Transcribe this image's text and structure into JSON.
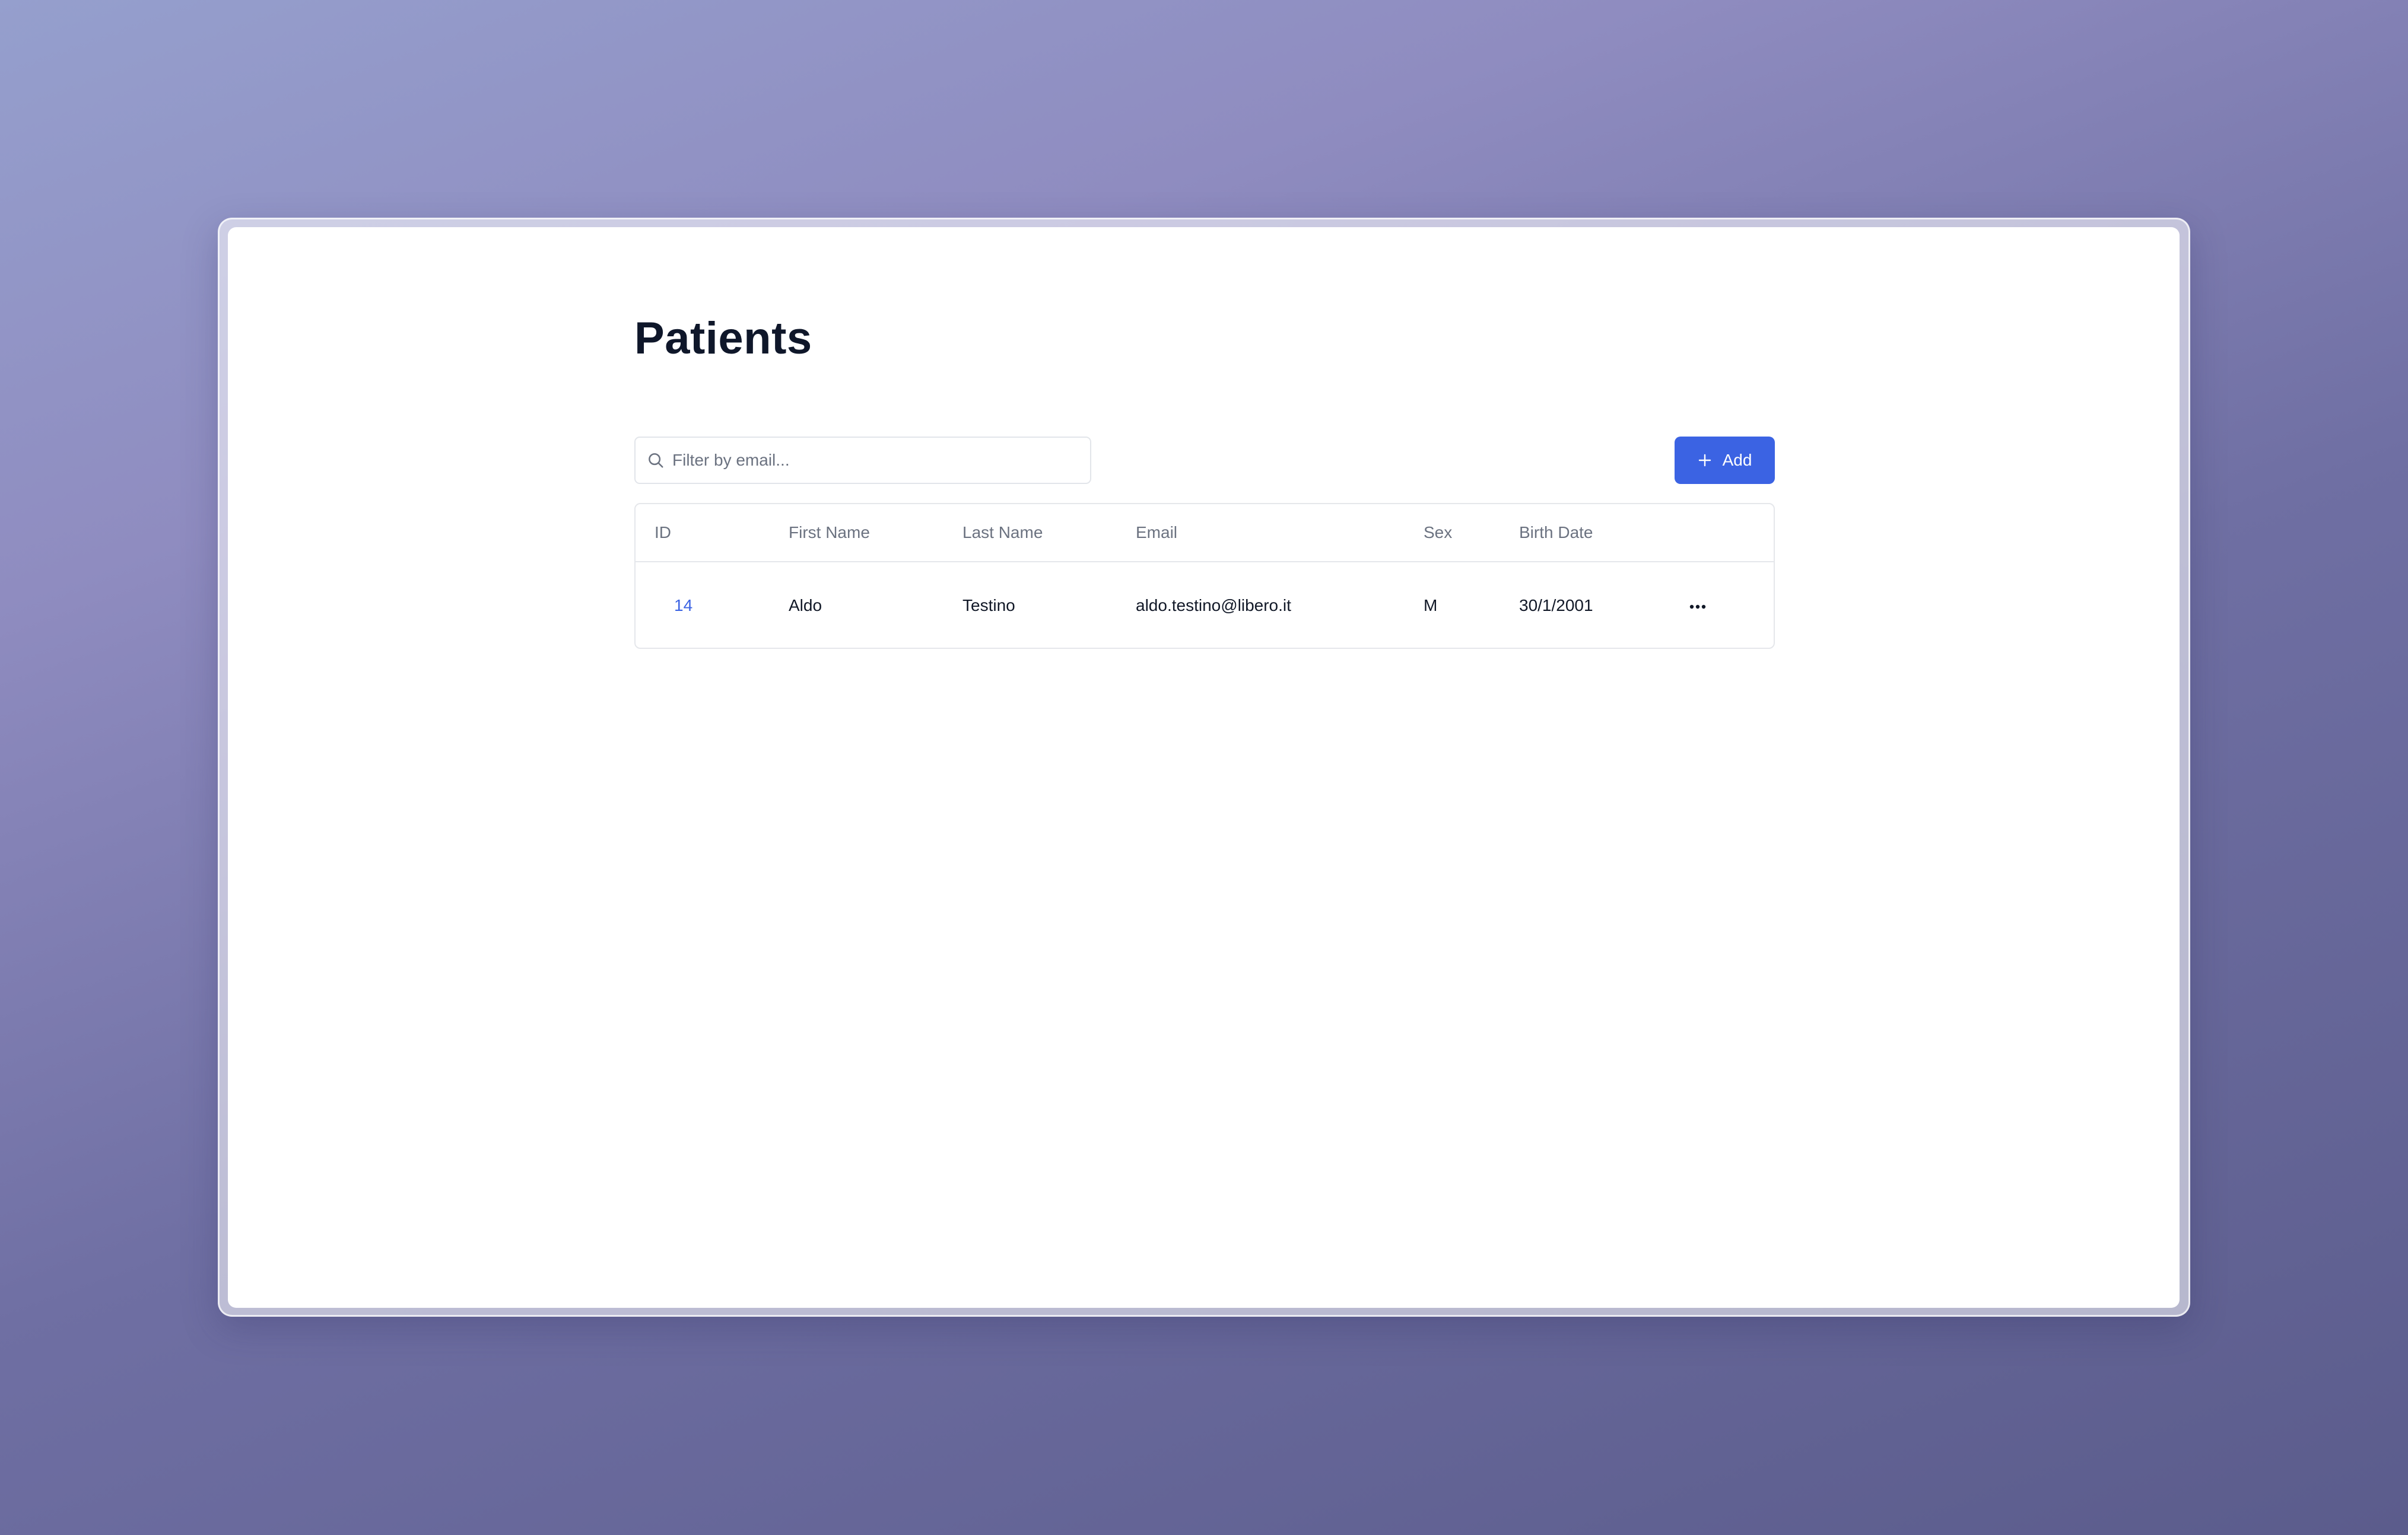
{
  "page": {
    "title": "Patients"
  },
  "toolbar": {
    "search_placeholder": "Filter by email...",
    "search_value": "",
    "add_label": "Add"
  },
  "table": {
    "columns": [
      "ID",
      "First Name",
      "Last Name",
      "Email",
      "Sex",
      "Birth Date"
    ],
    "rows": [
      {
        "id": "14",
        "first_name": "Aldo",
        "last_name": "Testino",
        "email": "aldo.testino@libero.it",
        "sex": "M",
        "birth_date": "30/1/2001",
        "actions_icon": "ellipsis-horizontal-icon"
      }
    ]
  },
  "icons": {
    "search": "search-icon",
    "add": "plus-icon",
    "row_actions": "more-horizontal-icon"
  },
  "colors": {
    "accent": "#3b63e3",
    "title": "#0f172a",
    "header_text": "#6b7280",
    "border": "#e5e7eb",
    "background_gradient_start": "#959fcd",
    "background_gradient_end": "#5b5c8c"
  }
}
